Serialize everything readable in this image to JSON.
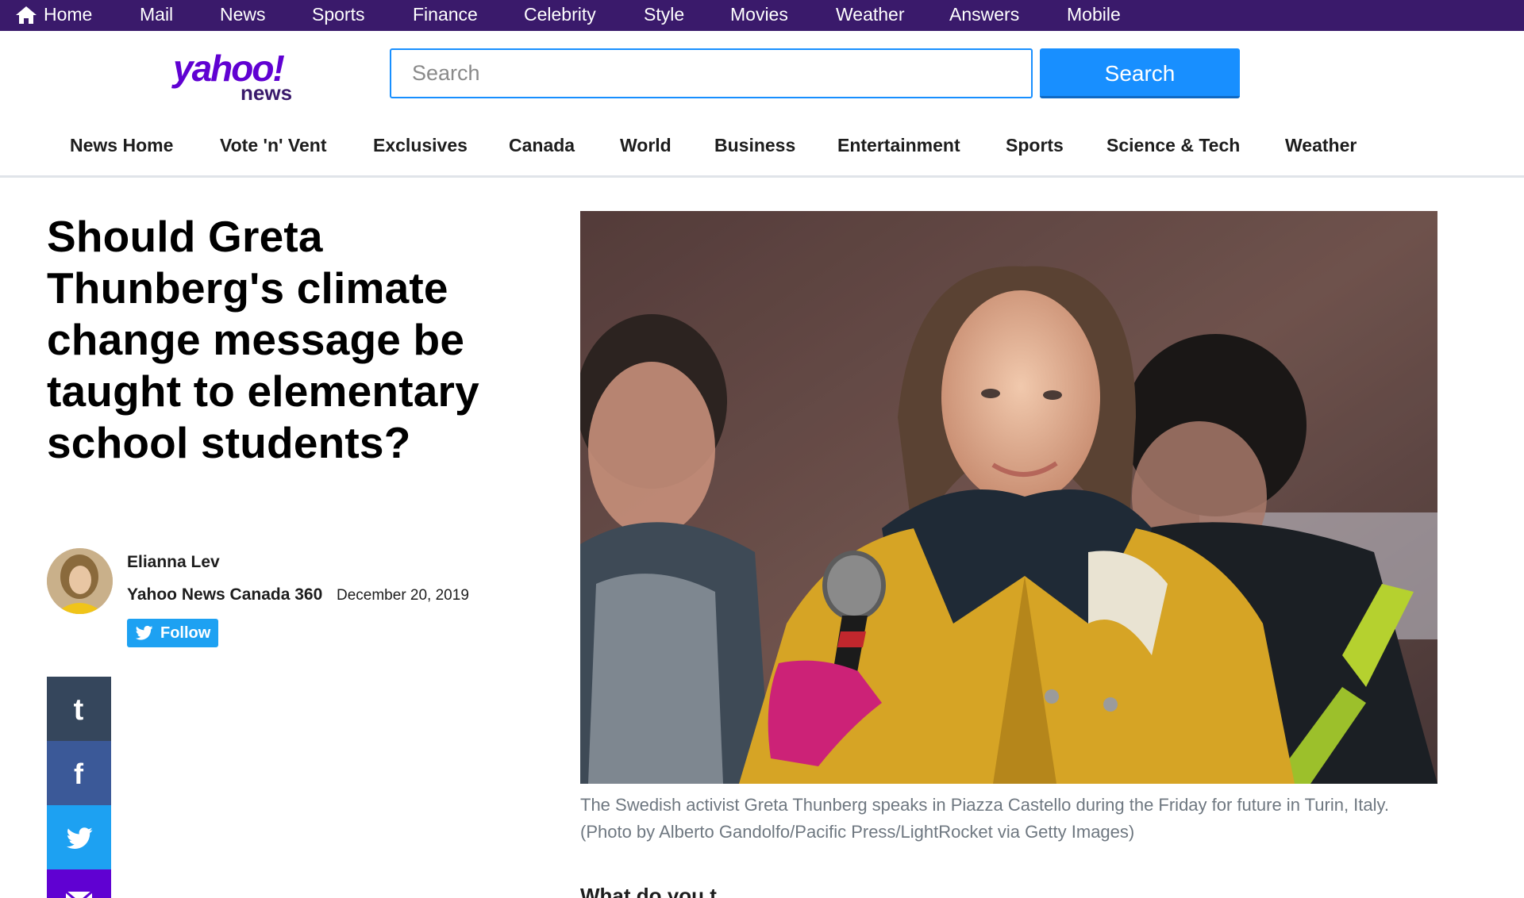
{
  "topbar": {
    "items": [
      {
        "label": "Home",
        "icon": "home-icon"
      },
      {
        "label": "Mail"
      },
      {
        "label": "News"
      },
      {
        "label": "Sports"
      },
      {
        "label": "Finance"
      },
      {
        "label": "Celebrity"
      },
      {
        "label": "Style"
      },
      {
        "label": "Movies"
      },
      {
        "label": "Weather"
      },
      {
        "label": "Answers"
      },
      {
        "label": "Mobile"
      }
    ]
  },
  "header": {
    "logo_main": "yahoo!",
    "logo_sub": "news",
    "search_placeholder": "Search",
    "search_button": "Search"
  },
  "subnav": {
    "items": [
      {
        "label": "News Home"
      },
      {
        "label": "Vote 'n' Vent"
      },
      {
        "label": "Exclusives"
      },
      {
        "label": "Canada"
      },
      {
        "label": "World"
      },
      {
        "label": "Business"
      },
      {
        "label": "Entertainment"
      },
      {
        "label": "Sports"
      },
      {
        "label": "Science & Tech"
      },
      {
        "label": "Weather"
      }
    ]
  },
  "article": {
    "headline": "Should Greta Thunberg's climate change message be taught to elementary school students?",
    "author": "Elianna Lev",
    "provider": "Yahoo News Canada 360",
    "date": "December 20, 2019",
    "follow_label": "Follow",
    "caption": "The Swedish activist Greta Thunberg speaks in Piazza Castello during the Friday for future in Turin, Italy. (Photo by Alberto Gandolfo/Pacific Press/LightRocket via Getty Images)",
    "next_heading": "What do you t"
  },
  "share": {
    "buttons": [
      {
        "icon": "tumblr-icon",
        "color": "#35465c"
      },
      {
        "icon": "facebook-icon",
        "color": "#3b5998"
      },
      {
        "icon": "twitter-icon",
        "color": "#1da1f2"
      },
      {
        "icon": "mail-icon",
        "color": "#6001d2"
      }
    ]
  },
  "colors": {
    "topbar": "#3a1a6b",
    "brand": "#6001d2",
    "search_button": "#188fff"
  }
}
